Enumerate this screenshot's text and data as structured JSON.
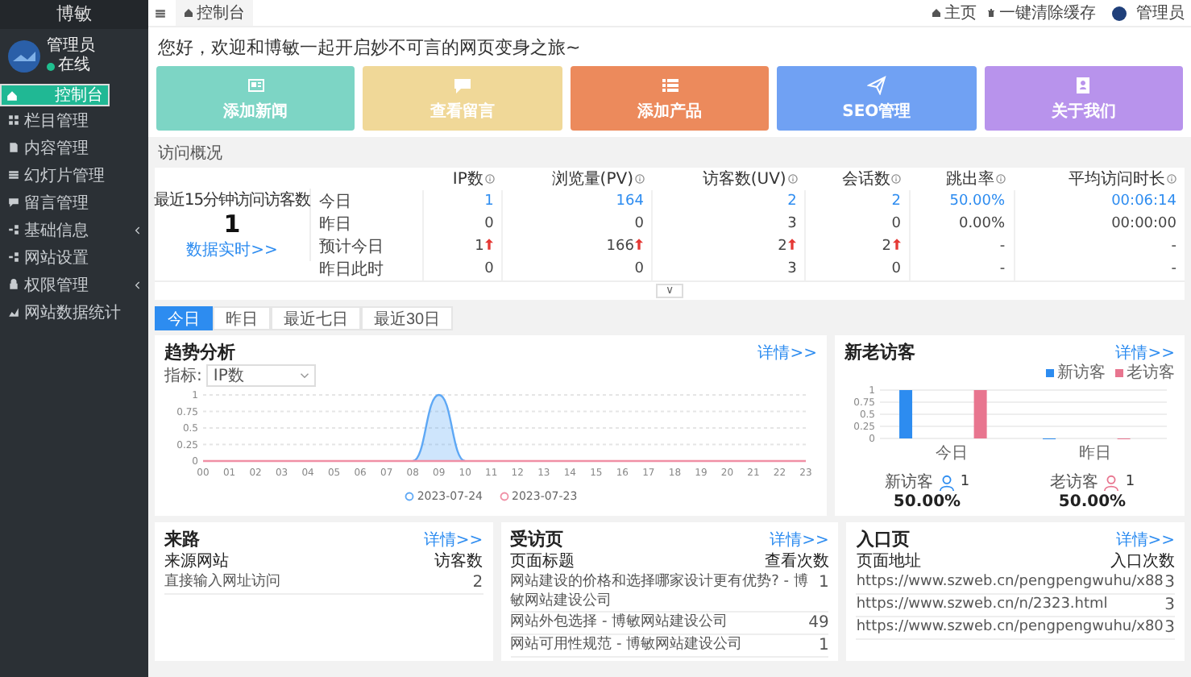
{
  "sidebar": {
    "title": "博敏",
    "user": {
      "name": "管理员",
      "status": "在线",
      "online": true
    },
    "items": [
      {
        "label": "控制台",
        "selected": true,
        "expandable": false
      },
      {
        "label": "栏目管理",
        "selected": false,
        "expandable": false
      },
      {
        "label": "内容管理",
        "selected": false,
        "expandable": false
      },
      {
        "label": "幻灯片管理",
        "selected": false,
        "expandable": false
      },
      {
        "label": "留言管理",
        "selected": false,
        "expandable": false
      },
      {
        "label": "基础信息",
        "selected": false,
        "expandable": true
      },
      {
        "label": "网站设置",
        "selected": false,
        "expandable": false
      },
      {
        "label": "权限管理",
        "selected": false,
        "expandable": true
      },
      {
        "label": "网站数据统计",
        "selected": false,
        "expandable": false
      }
    ]
  },
  "topbar": {
    "tab": "控制台",
    "links": [
      "主页",
      "一键清除缓存"
    ],
    "user": "管理员"
  },
  "greeting": "您好，欢迎和博敏一起开启妙不可言的网页变身之旅~",
  "shortcuts": [
    {
      "label": "添加新闻",
      "color": "#7dd5c5"
    },
    {
      "label": "查看留言",
      "color": "#f0d898"
    },
    {
      "label": "添加产品",
      "color": "#ec8a5c"
    },
    {
      "label": "SEO管理",
      "color": "#70a1f3"
    },
    {
      "label": "关于我们",
      "color": "#b893ec"
    }
  ],
  "overview": {
    "title": "访问概况",
    "realtime": {
      "label": "最近15分钟访问访客数",
      "value": "1",
      "link": "数据实时>>"
    },
    "columns": [
      "IP数",
      "浏览量(PV)",
      "访客数(UV)",
      "会话数",
      "跳出率",
      "平均访问时长"
    ],
    "rows": [
      {
        "label": "今日",
        "kind": "today",
        "cells": [
          "1",
          "164",
          "2",
          "2",
          "50.00%",
          "00:06:14"
        ]
      },
      {
        "label": "昨日",
        "kind": "normal",
        "cells": [
          "0",
          "0",
          "3",
          "0",
          "0.00%",
          "00:00:00"
        ]
      },
      {
        "label": "预计今日",
        "kind": "forecast",
        "cells": [
          "1",
          "166",
          "2",
          "2",
          "-",
          "-"
        ],
        "rising": [
          true,
          true,
          true,
          true,
          false,
          false
        ]
      },
      {
        "label": "昨日此时",
        "kind": "normal",
        "cells": [
          "0",
          "0",
          "3",
          "0",
          "-",
          "-"
        ]
      }
    ],
    "expand_button": "∨"
  },
  "date_tabs": [
    {
      "label": "今日",
      "selected": true
    },
    {
      "label": "昨日",
      "selected": false
    },
    {
      "label": "最近七日",
      "selected": false
    },
    {
      "label": "最近30日",
      "selected": false
    }
  ],
  "trend": {
    "title": "趋势分析",
    "details": "详情>>",
    "metric_label": "指标:",
    "metric": "IP数",
    "chart_data": {
      "type": "line",
      "grid": true,
      "x": [
        "00",
        "01",
        "02",
        "03",
        "04",
        "05",
        "06",
        "07",
        "08",
        "09",
        "10",
        "11",
        "12",
        "13",
        "14",
        "15",
        "16",
        "17",
        "18",
        "19",
        "20",
        "21",
        "22",
        "23"
      ],
      "yticks": [
        0,
        {
          "value": 0.25,
          "label": "0.25"
        },
        {
          "value": 0.5,
          "label": "0.5"
        },
        {
          "value": 0.75,
          "label": "0.75"
        },
        1
      ],
      "ylim": [
        0,
        1
      ],
      "series": [
        {
          "name": "2023-07-24",
          "color": "#5ea8f5",
          "values": [
            null,
            null,
            null,
            null,
            null,
            null,
            null,
            null,
            0,
            1,
            0,
            null,
            null,
            null,
            null,
            null,
            null,
            null,
            null,
            null,
            null,
            null,
            null,
            null
          ]
        },
        {
          "name": "2023-07-23",
          "color": "#f08fa5",
          "values": [
            0,
            0,
            0,
            0,
            0,
            0,
            0,
            0,
            0,
            0,
            0,
            0,
            0,
            0,
            0,
            0,
            0,
            0,
            0,
            0,
            0,
            0,
            0,
            0
          ]
        }
      ]
    }
  },
  "visitors": {
    "title": "新老访客",
    "details": "详情>>",
    "chart_data": {
      "type": "bar",
      "grid": true,
      "categories": [
        "今日",
        "昨日"
      ],
      "yticks": [
        0,
        {
          "value": 0.25,
          "label": "0.25"
        },
        {
          "value": 0.5,
          "label": "0.5"
        },
        {
          "value": 0.75,
          "label": "0.75"
        },
        1
      ],
      "ylim": [
        0,
        1
      ],
      "series": [
        {
          "name": "新访客",
          "color": "#2d8cf0",
          "values": [
            1,
            0
          ]
        },
        {
          "name": "老访客",
          "color": "#e8758f",
          "values": [
            1,
            0
          ]
        }
      ]
    },
    "stats": [
      {
        "label": "新访客",
        "count": "1",
        "share": "50.00%",
        "color": "#2d8cf0"
      },
      {
        "label": "老访客",
        "count": "1",
        "share": "50.00%",
        "color": "#e8758f"
      }
    ]
  },
  "panels": [
    {
      "title": "来路",
      "details": "详情>>",
      "columns": [
        "来源网站",
        "访客数"
      ],
      "rows": [
        [
          "直接输入网址访问",
          "2"
        ]
      ]
    },
    {
      "title": "受访页",
      "details": "详情>>",
      "columns": [
        "页面标题",
        "查看次数"
      ],
      "rows": [
        [
          "网站建设的价格和选择哪家设计更有优势? - 博敏网站建设公司",
          "1"
        ],
        [
          "网站外包选择 - 博敏网站建设公司",
          "49"
        ],
        [
          "网站可用性规范 - 博敏网站建设公司",
          "1"
        ]
      ]
    },
    {
      "title": "入口页",
      "details": "详情>>",
      "columns": [
        "页面地址",
        "入口次数"
      ],
      "rows": [
        [
          "https://www.szweb.cn/pengpengwuhu/x88",
          "3"
        ],
        [
          "https://www.szweb.cn/n/2323.html",
          "3"
        ],
        [
          "https://www.szweb.cn/pengpengwuhu/x80",
          "3"
        ]
      ]
    }
  ]
}
